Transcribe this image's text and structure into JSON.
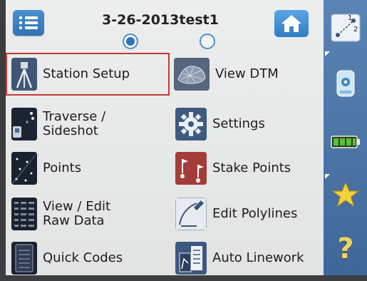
{
  "header": {
    "job_name": "3-26-2013test1",
    "page_count": 2,
    "current_page": 1
  },
  "menu": {
    "left": [
      {
        "label": "Station Setup",
        "icon": "tripod-icon",
        "selected": true
      },
      {
        "label": "Traverse /\nSideshot",
        "icon": "traverse-icon"
      },
      {
        "label": "Points",
        "icon": "points-icon"
      },
      {
        "label": "View / Edit\nRaw Data",
        "icon": "raw-data-icon"
      },
      {
        "label": "Quick Codes",
        "icon": "quick-codes-icon"
      }
    ],
    "right": [
      {
        "label": "View DTM",
        "icon": "dtm-icon"
      },
      {
        "label": "Settings",
        "icon": "gear-icon"
      },
      {
        "label": "Stake Points",
        "icon": "stake-points-icon"
      },
      {
        "label": "Edit Polylines",
        "icon": "polyline-icon"
      },
      {
        "label": "Auto Linework",
        "icon": "auto-linework-icon"
      }
    ]
  },
  "rail": {
    "items": [
      "point-pair-icon",
      "instrument-icon",
      "battery-icon",
      "star-icon",
      "help-icon"
    ],
    "point_pair_labels": [
      "1",
      "2"
    ],
    "help_glyph": "?"
  },
  "colors": {
    "accent_blue": "#2f72b6",
    "rail_blue": "#4a72a6",
    "selection_red": "#c43a34",
    "star_yellow": "#f3d23a",
    "battery_green": "#5bbf3a"
  }
}
